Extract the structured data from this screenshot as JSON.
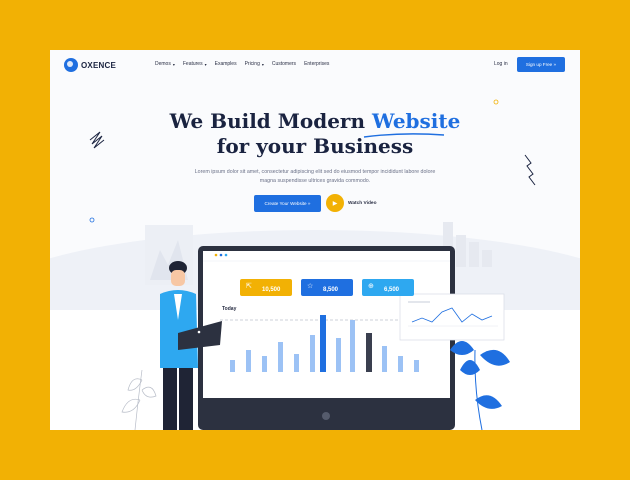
{
  "brand": {
    "name": "OXENCE"
  },
  "nav": {
    "items": [
      {
        "label": "Demos",
        "dropdown": true
      },
      {
        "label": "Features",
        "dropdown": true
      },
      {
        "label": "Examples",
        "dropdown": false
      },
      {
        "label": "Pricing",
        "dropdown": true
      },
      {
        "label": "Customers",
        "dropdown": false
      },
      {
        "label": "Enterprises",
        "dropdown": false
      }
    ],
    "login_label": "Log in",
    "signup_label": "Sign up Free »"
  },
  "hero": {
    "title_line1_a": "We Build Modern ",
    "title_line1_b": "Website",
    "title_line2": "for your Business",
    "subtitle": "Lorem ipsum dolor sit amet, consectetur adipiscing elit sed do eiusmod tempor incididunt labore dolore magna suspendisse ultrices gravida commodo.",
    "cta_label": "Create Your Website »",
    "watch_label": "Watch Video"
  },
  "dashboard": {
    "today_label": "Today",
    "cards": [
      {
        "value": "10,500",
        "color": "#f2b104"
      },
      {
        "value": "8,500",
        "color": "#1f6fe0"
      },
      {
        "value": "6,500",
        "color": "#2ea8f0"
      }
    ]
  },
  "colors": {
    "accent": "#1f6fe0",
    "background": "#f2b104",
    "title": "#1a2340"
  },
  "icons": {
    "cursor": "cursor-icon",
    "star": "star-icon",
    "plus": "plus-circle-icon",
    "play": "play-icon"
  }
}
